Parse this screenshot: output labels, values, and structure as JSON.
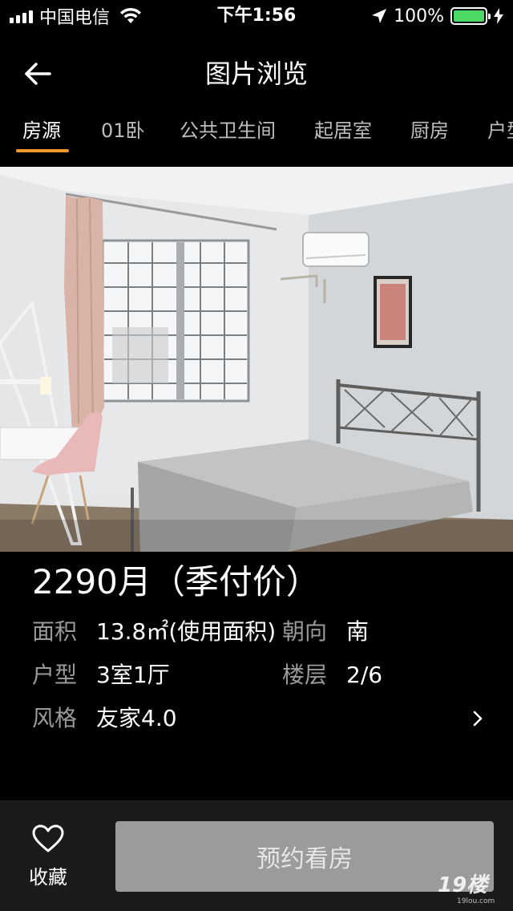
{
  "status_bar": {
    "carrier": "中国电信",
    "time": "下午1:56",
    "battery": "100%",
    "battery_level": 1.0,
    "icons": [
      "signal-icon",
      "wifi-icon",
      "location-arrow-icon",
      "battery-icon",
      "charging-bolt-icon"
    ]
  },
  "nav": {
    "title": "图片浏览",
    "back_icon": "back-arrow-icon"
  },
  "tabs": [
    {
      "label": "房源",
      "active": true
    },
    {
      "label": "01卧",
      "active": false
    },
    {
      "label": "公共卫生间",
      "active": false
    },
    {
      "label": "起居室",
      "active": false
    },
    {
      "label": "厨房",
      "active": false
    },
    {
      "label": "户型",
      "active": false
    }
  ],
  "photo": {
    "subject": "bedroom-photo"
  },
  "listing": {
    "price": "2290月（季付价）",
    "area_label": "面积",
    "area_value": "13.8㎡(使用面积)",
    "orientation_label": "朝向",
    "orientation_value": "南",
    "layout_label": "户型",
    "layout_value": "3室1厅",
    "floor_label": "楼层",
    "floor_value": "2/6",
    "style_label": "风格",
    "style_value": "友家4.0"
  },
  "bottom_bar": {
    "favorite_label": "收藏",
    "book_label": "预约看房",
    "watermark": "19楼",
    "watermark_sub": "19lou.com"
  },
  "colors": {
    "accent": "#f39a2e",
    "background": "#000000",
    "bottom_bar": "#1b1b1b",
    "button_disabled": "#9b9b9b",
    "label_gray": "#9a9a9a",
    "battery_green": "#4cd964"
  }
}
